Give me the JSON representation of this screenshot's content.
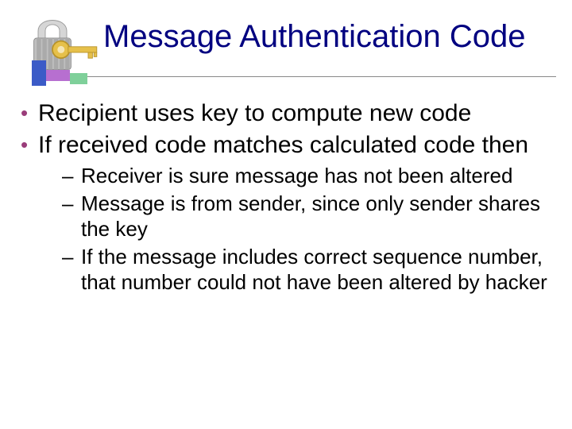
{
  "title": "Message Authentication Code",
  "bullets": [
    {
      "text": "Recipient uses key to compute new code"
    },
    {
      "text": "If received code matches calculated code then"
    }
  ],
  "sub_bullets": [
    {
      "text": "Receiver is sure message has not been altered"
    },
    {
      "text": "Message is from sender, since only sender shares the key"
    },
    {
      "text": "If the message includes correct sequence number, that number could not have been altered by hacker"
    }
  ],
  "colors": {
    "title": "#000080",
    "bullet_marker": "#9a3d7a"
  }
}
